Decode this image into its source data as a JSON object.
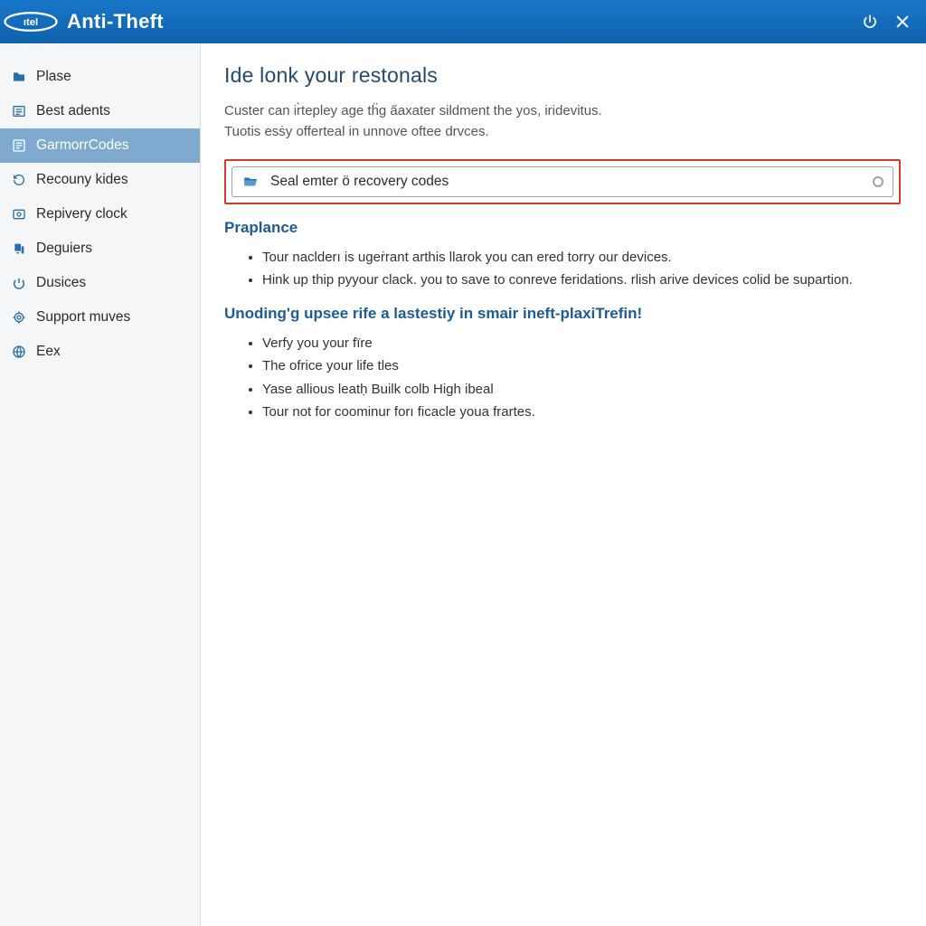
{
  "titlebar": {
    "brand": "Anti-Theft"
  },
  "sidebar": {
    "items": [
      {
        "label": "Plase",
        "icon": "folder-icon",
        "selected": false
      },
      {
        "label": "Best adents",
        "icon": "list-icon",
        "selected": false
      },
      {
        "label": "GarmorrCodes",
        "icon": "codes-icon",
        "selected": true
      },
      {
        "label": "Recouny kides",
        "icon": "recovery-icon",
        "selected": false
      },
      {
        "label": "Repivery clock",
        "icon": "clock-icon",
        "selected": false
      },
      {
        "label": "Deguiers",
        "icon": "devices-icon",
        "selected": false
      },
      {
        "label": "Dusices",
        "icon": "power-icon",
        "selected": false
      },
      {
        "label": "Support muves",
        "icon": "support-icon",
        "selected": false
      },
      {
        "label": "Eex",
        "icon": "globe-icon",
        "selected": false
      }
    ]
  },
  "main": {
    "title": "Ide lonk your restonals",
    "intro": [
      "Custer can ir̀tepley age tḧg a̋axater sildment the yos, iridevitus.",
      "Tuotis esṡy offerteal in unnove oftee drvces."
    ],
    "search": {
      "value": "Seal emter ö recovery codes"
    },
    "section1": {
      "heading": "Praplance",
      "items": [
        "Tour naclderı is ugeṙrant arthis llarok you can ered torry our devices.",
        "Hink up thip pyyour clack. you to save to conreve feridations. rlish arive devices colid be supartion."
      ]
    },
    "section2": {
      "heading": "Unoding'g upsee rife a lastestiy in smair ineft-plaxiTrefin!",
      "items": [
        "Verfy you your fïre",
        "The ofrice your life tles",
        "Yase allious leatḥ Builk colb High ibeal",
        "Tour not for coominur forı ficacle youa frartes."
      ]
    }
  }
}
